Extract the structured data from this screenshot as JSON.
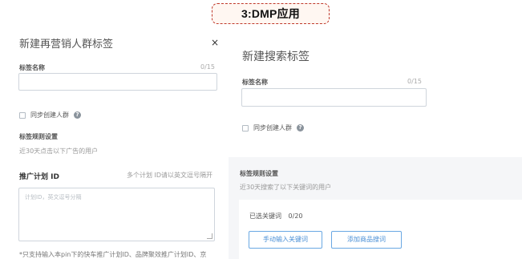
{
  "banner": {
    "text": "3:DMP应用"
  },
  "left_panel": {
    "title": "新建再营销人群标签",
    "close_label": "×",
    "name_label": "标签名称",
    "name_counter": "0/15",
    "sync_label": "同步创建人群",
    "help_icon": "?",
    "rule_label": "标签规则设置",
    "rule_desc": "近30天点击以下广告的用户",
    "plan_label": "推广计划 ID",
    "plan_hint": "多个计划 ID请以英文逗号隔开",
    "plan_placeholder": "计划ID，英文逗号分隔",
    "footnote": "*只支持输入本pin下的快车推广计划ID、品牌聚效推广计划ID、京"
  },
  "right_panel": {
    "title": "新建搜索标签",
    "name_label": "标签名称",
    "name_counter": "0/15",
    "sync_label": "同步创建人群",
    "help_icon": "?",
    "rule_label": "标签规则设置",
    "rule_desc": "近30天搜索了以下关键词的用户",
    "selected_label": "已选关键词",
    "selected_count": "0/20",
    "manual_button": "手动输入关键词",
    "add_product_button": "添加商品搜词"
  }
}
